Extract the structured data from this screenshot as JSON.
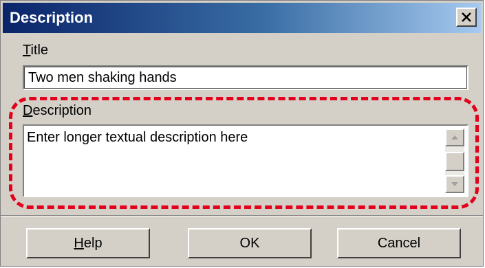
{
  "dialog": {
    "title": "Description",
    "close_glyph": "×",
    "close_icon": "close-icon"
  },
  "fields": {
    "title_label_mnemonic": "T",
    "title_label_rest": "itle",
    "title_value": "Two men shaking hands",
    "description_label_mnemonic": "D",
    "description_label_rest": "escription",
    "description_value": "Enter longer textual description here"
  },
  "highlight": {
    "color": "#e3001b",
    "style": "dashed"
  },
  "buttons": {
    "help_mnemonic": "H",
    "help_rest": "elp",
    "ok_label": "OK",
    "cancel_label": "Cancel"
  },
  "icons": {
    "scroll_up": "scroll-up-arrow-icon",
    "scroll_down": "scroll-down-arrow-icon"
  }
}
